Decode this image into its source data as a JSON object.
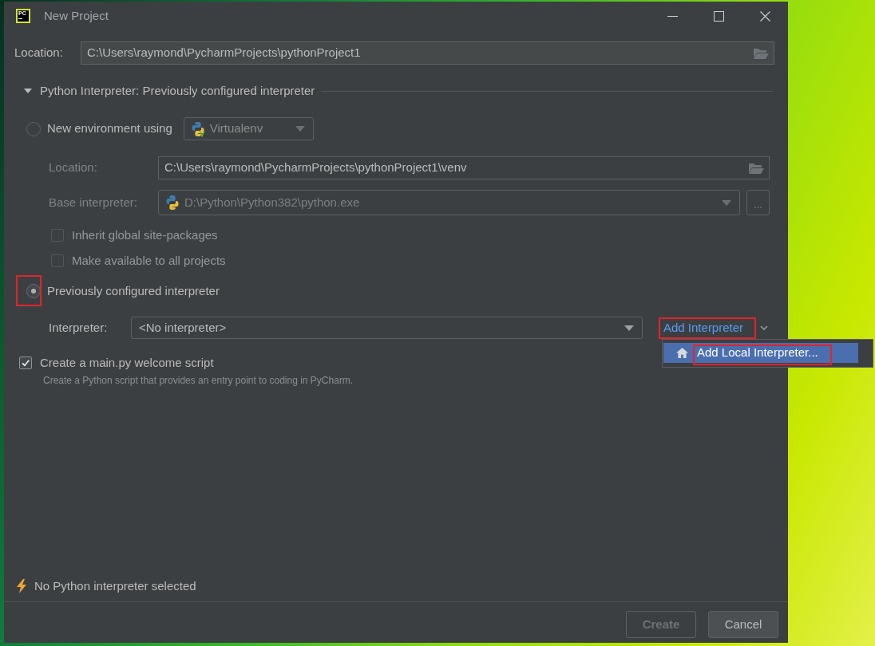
{
  "window": {
    "logo_text": "PC",
    "title": "New Project"
  },
  "location": {
    "label": "Location:",
    "value": "C:\\Users\\raymond\\PycharmProjects\\pythonProject1"
  },
  "interpreter_section": {
    "title": "Python Interpreter: Previously configured interpreter",
    "expanded": true,
    "options": [
      {
        "kind": "new_environment",
        "label": "New environment using",
        "selected": false,
        "environment_tool": "Virtualenv",
        "fields": [
          {
            "kind": "path",
            "label": "Location:",
            "value": "C:\\Users\\raymond\\PycharmProjects\\pythonProject1\\venv",
            "disabled": false
          },
          {
            "kind": "combo",
            "label": "Base interpreter:",
            "value": "D:\\Python\\Python382\\python.exe",
            "disabled": true,
            "button": "..."
          }
        ],
        "checkboxes": [
          {
            "label": "Inherit global site-packages",
            "checked": false,
            "disabled": true
          },
          {
            "label": "Make available to all projects",
            "checked": false,
            "disabled": true
          }
        ]
      },
      {
        "kind": "existing",
        "label": "Previously configured interpreter",
        "selected": true,
        "highlighted": true,
        "interpreter": {
          "label": "Interpreter:",
          "value": "<No interpreter>"
        },
        "add_interpreter": {
          "label": "Add Interpreter",
          "highlighted": true,
          "menu": [
            {
              "label": "Add Local Interpreter...",
              "selected": true,
              "highlighted": true
            }
          ]
        }
      }
    ]
  },
  "welcome_script": {
    "label": "Create a main.py welcome script",
    "checked": true,
    "description": "Create a Python script that provides an entry point to coding in PyCharm."
  },
  "status": {
    "message": "No Python interpreter selected"
  },
  "buttons": [
    {
      "label": "Create",
      "default": true,
      "disabled": true
    },
    {
      "label": "Cancel",
      "default": false,
      "disabled": false
    }
  ]
}
